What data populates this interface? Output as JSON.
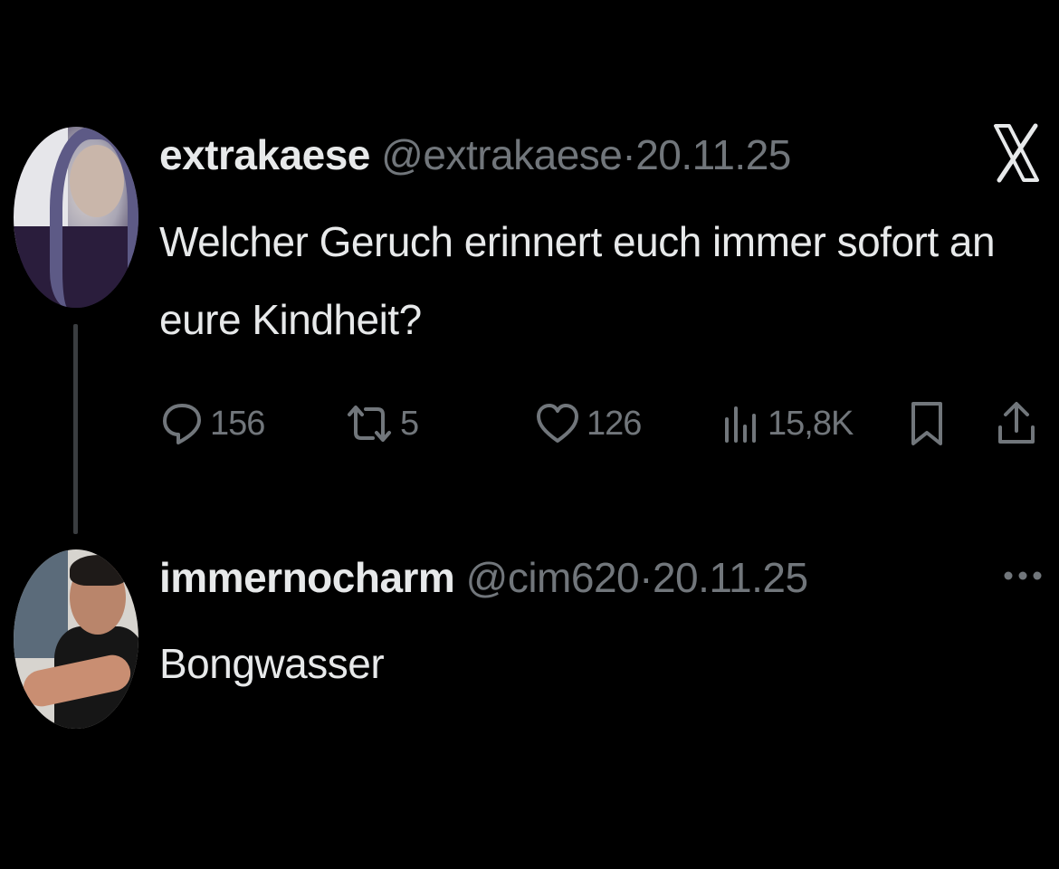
{
  "colors": {
    "background": "#000000",
    "primary_text": "#e7e9ea",
    "secondary_text": "#71767b",
    "thread_line": "#3a3d40"
  },
  "tweet": {
    "display_name": "extrakaese",
    "handle": "@extrakaese",
    "separator": "·",
    "date": "20.11.25",
    "text": "Welcher Geruch erinnert euch immer sofort an eure Kindheit?",
    "brand_icon": "x-logo-icon",
    "actions": {
      "replies": "156",
      "reposts": "5",
      "likes": "126",
      "views": "15,8K"
    }
  },
  "reply": {
    "display_name": "immernocharm",
    "handle": "@cim620",
    "separator": "·",
    "date": "20.11.25",
    "text": "Bongwasser",
    "menu_icon": "more-icon"
  }
}
